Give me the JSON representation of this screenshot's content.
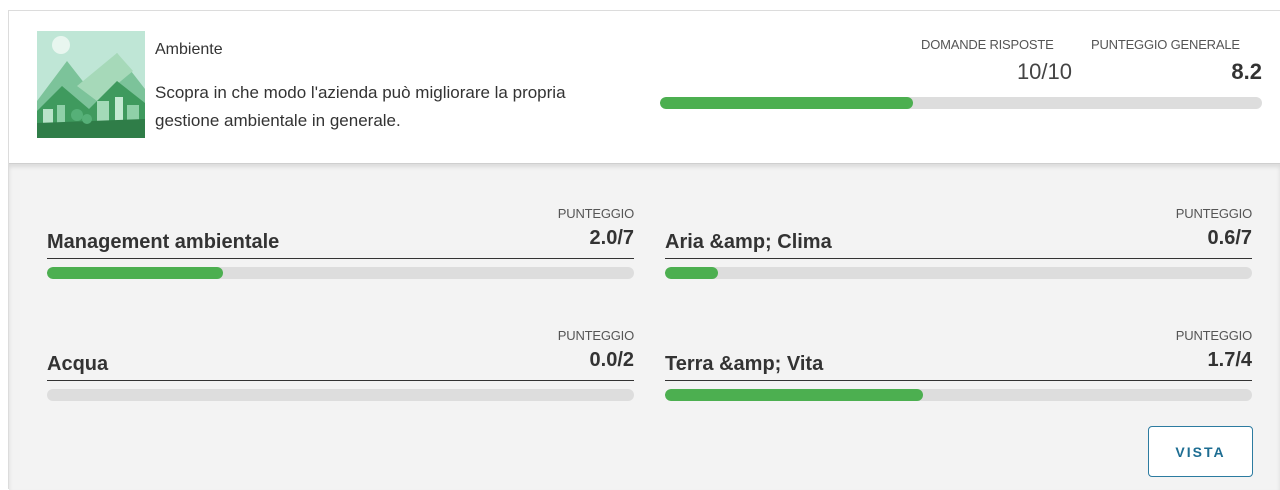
{
  "header": {
    "title": "Ambiente",
    "description": "Scopra in che modo l'azienda può migliorare la propria gestione ambientale in generale.",
    "thumbnail_icon": "landscape-illustration",
    "questions_label": "DOMANDE RISPOSTE",
    "questions_value": "10/10",
    "score_label": "PUNTEGGIO GENERALE",
    "score_value": "8.2",
    "progress": 0.42
  },
  "categories": [
    {
      "name": "Management ambientale",
      "score_label": "PUNTEGGIO",
      "score": "2.0/7",
      "progress": 0.3
    },
    {
      "name": "Aria &amp; Clima",
      "score_label": "PUNTEGGIO",
      "score": "0.6/7",
      "progress": 0.09
    },
    {
      "name": "Acqua",
      "score_label": "PUNTEGGIO",
      "score": "0.0/2",
      "progress": 0.0
    },
    {
      "name": "Terra &amp; Vita",
      "score_label": "PUNTEGGIO",
      "score": "1.7/4",
      "progress": 0.44
    }
  ],
  "actions": {
    "view_label": "VISTA"
  },
  "colors": {
    "progress_fill": "#4caf50",
    "progress_track": "#dddddd",
    "button_accent": "#1d6d92"
  }
}
